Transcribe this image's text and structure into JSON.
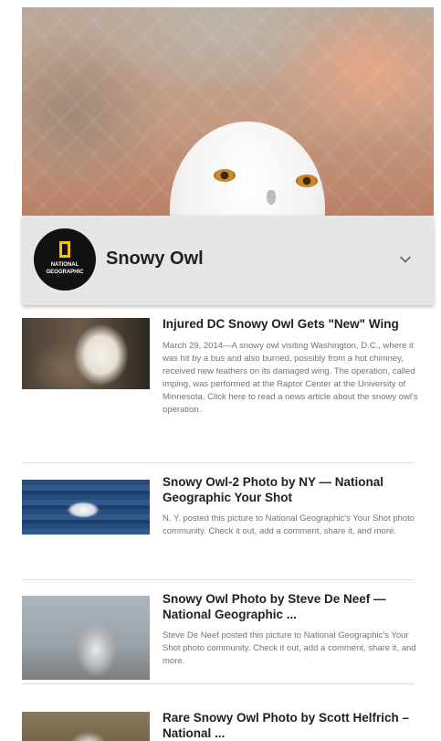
{
  "header": {
    "title": "Snowy Owl",
    "logo_line1": "NATIONAL",
    "logo_line2": "GEOGRAPHIC"
  },
  "icons": {
    "expand": "chevron-down-icon",
    "logo": "national-geographic-logo"
  },
  "results": [
    {
      "title": "Injured DC Snowy Owl Gets \"New\" Wing",
      "snippet": "March 29, 2014—A snowy owl visiting Washington, D.C., where it was hit by a bus and also burned, possibly from a hot chimney, received new feathers on its damaged wing. The operation, called imping, was performed at the Raptor Center at the University of Minnesota. Click here to read a news article about the snowy owl's operation."
    },
    {
      "title": "Snowy Owl-2 Photo by NY — National Geographic Your Shot",
      "snippet": "N. Y. posted this picture to National Geographic's Your Shot photo community. Check it out, add a comment, share it, and more."
    },
    {
      "title": "Snowy Owl Photo by Steve De Neef — National Geographic ...",
      "snippet": "Steve De Neef posted this picture to National Geographic's Your Shot photo community. Check it out, add a comment, share it, and more."
    },
    {
      "title": "Rare Snowy Owl Photo by Scott Helfrich – National ...",
      "snippet": ""
    }
  ],
  "colors": {
    "header_bg": "#e6e6e6",
    "title_text": "#202124",
    "snippet_text": "#70757a",
    "logo_accent": "#f5c400"
  }
}
